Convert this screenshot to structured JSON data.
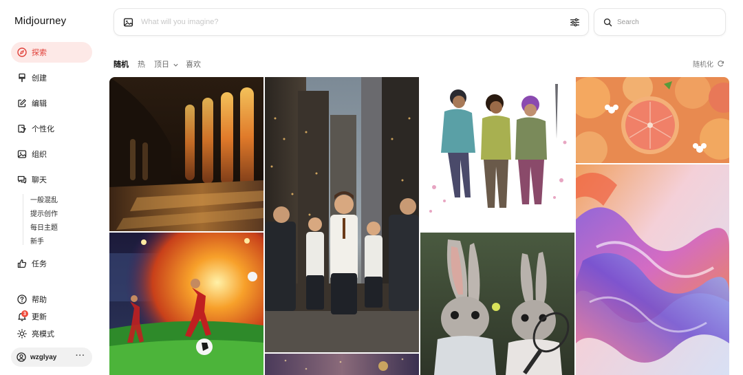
{
  "app": {
    "brand": "Midjourney"
  },
  "nav": {
    "explore": "探索",
    "create": "创建",
    "edit": "编辑",
    "personalize": "个性化",
    "organize": "组织",
    "chat": "聊天",
    "chat_rooms": [
      "一般混乱",
      "提示创作",
      "每日主题",
      "新手"
    ],
    "tasks": "任务",
    "help": "帮助",
    "updates": "更新",
    "updates_badge": "3",
    "light_mode": "亮模式"
  },
  "user": {
    "name": "wzglyay",
    "menu": "···"
  },
  "imagine": {
    "placeholder": "What will you imagine?"
  },
  "search": {
    "placeholder": "Search"
  },
  "tabs": {
    "random": "随机",
    "hot": "热",
    "top_day": "顶日",
    "likes": "喜欢"
  },
  "shuffle": {
    "label": "随机化"
  },
  "colors": {
    "accent": "#e0413a",
    "accent_bg": "#fde9e7",
    "badge": "#ef4a3a"
  },
  "gallery": [
    "gothic cathedral interior with stained glass windows",
    "boys in suits walking in a city street",
    "three illustrated adventurers",
    "citrus fruit slices",
    "soccer player kicking a flaming ball",
    "two rabbits with tennis racket",
    "iridescent glass abstract shape"
  ]
}
